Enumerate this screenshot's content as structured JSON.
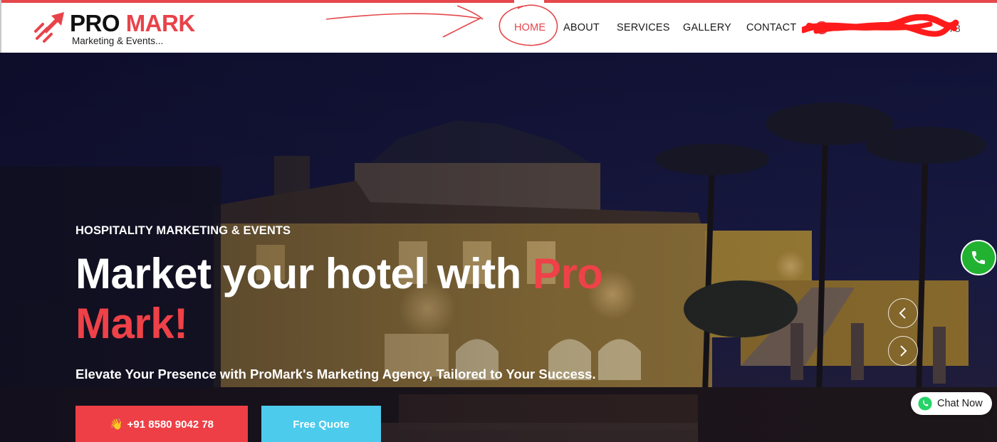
{
  "brand": {
    "name_part1": "PRO",
    "name_part2": "MARK",
    "tagline": "Marketing & Events..."
  },
  "nav": {
    "items": [
      {
        "label": "HOME",
        "active": true
      },
      {
        "label": "ABOUT"
      },
      {
        "label": "SERVICES"
      },
      {
        "label": "GALLERY"
      },
      {
        "label": "CONTACT"
      }
    ],
    "phone_visible_fragment": "78"
  },
  "hero": {
    "kicker": "HOSPITALITY MARKETING & EVENTS",
    "title_line1": "Market your hotel with ",
    "title_accent1": "Pro",
    "title_accent2": "Mark!",
    "subtitle": "Elevate Your Presence with ProMark's Marketing Agency, Tailored to Your Success.",
    "call_button": "+91 8580 9042 78",
    "quote_button": "Free Quote"
  },
  "widgets": {
    "chat_label": "Chat Now"
  },
  "colors": {
    "accent_red": "#e8434a",
    "button_red": "#ee3f46",
    "button_cyan": "#4ccbec",
    "whatsapp_green": "#22b231"
  },
  "icons": [
    "logo-rocket-icon",
    "phone-icon",
    "hand-icon",
    "chevron-left-icon",
    "chevron-right-icon",
    "whatsapp-icon"
  ]
}
